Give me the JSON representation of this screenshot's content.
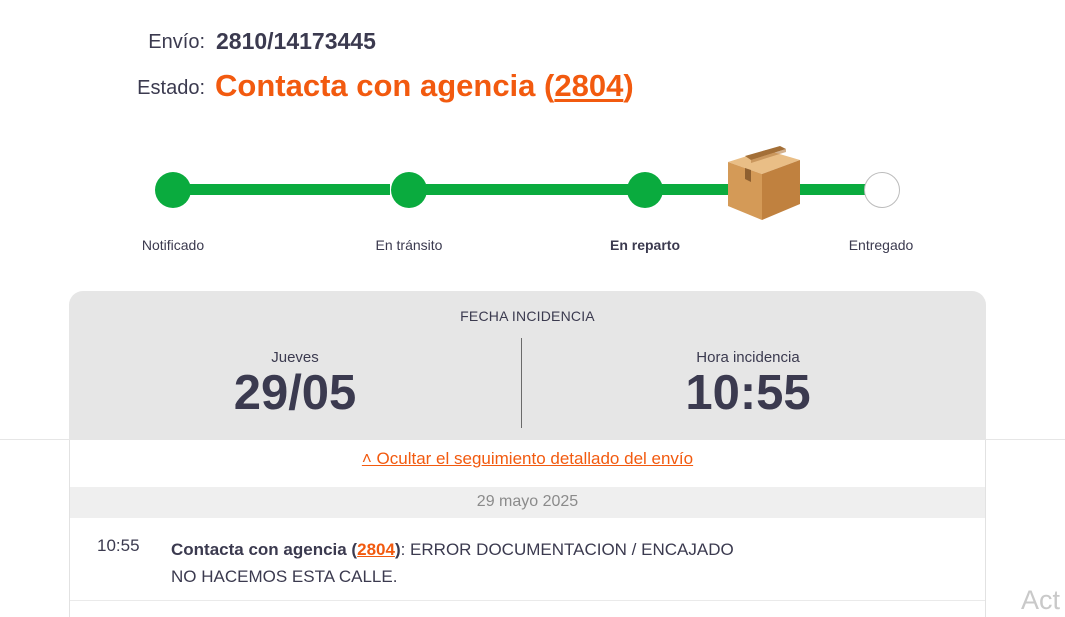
{
  "shipment": {
    "envio_label": "Envío:",
    "envio_value": "2810/14173445",
    "estado_label": "Estado:",
    "estado_text": "Contacta con agencia (",
    "estado_agency": "2804",
    "estado_close": ")"
  },
  "tracker": {
    "steps": [
      {
        "label": "Notificado",
        "state": "done"
      },
      {
        "label": "En tránsito",
        "state": "done"
      },
      {
        "label": "En reparto",
        "state": "current"
      },
      {
        "label": "Entregado",
        "state": "pending"
      }
    ],
    "current_icon": "package-box-icon",
    "colors": {
      "done": "#0aab3e",
      "pending": "#ffffff",
      "accent": "#f25a0f"
    }
  },
  "incident": {
    "title": "FECHA INCIDENCIA",
    "day_label": "Jueves",
    "date": "29/05",
    "time_label": "Hora incidencia",
    "time": "10:55"
  },
  "details": {
    "toggle_label": "˄ Ocultar el seguimiento detallado del envío",
    "date_header": "29 mayo 2025",
    "events": [
      {
        "time": "10:55",
        "status": "Contacta con agencia (",
        "agency": "2804",
        "status_close": ")",
        "message_1": ": ERROR DOCUMENTACION / ENCAJADO",
        "message_2": "NO HACEMOS ESTA CALLE."
      }
    ]
  },
  "watermark": "Act"
}
